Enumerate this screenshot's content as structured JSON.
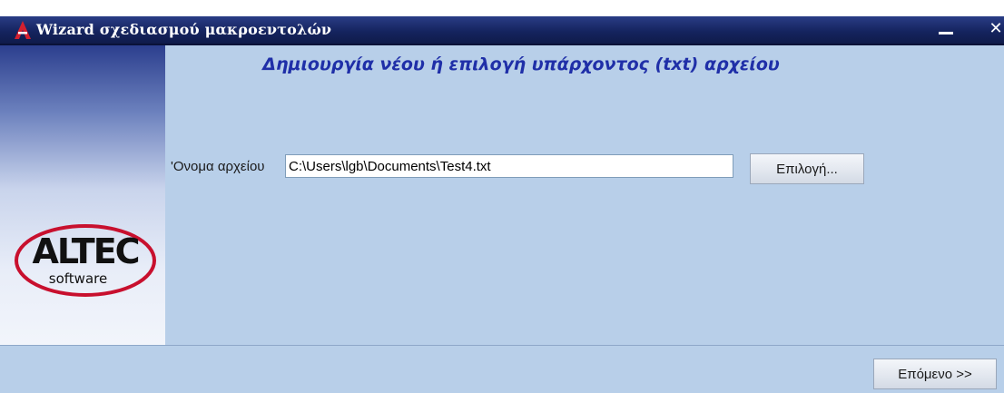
{
  "window": {
    "title": "Wizard σχεδιασμού μακροεντολών"
  },
  "brand": {
    "logo_text": "ALTEC",
    "logo_subtext": "software",
    "accent_red": "#c8102e",
    "title_bar_color": "#15245f"
  },
  "main": {
    "heading": "Δημιουργία νέου ή επιλογή υπάρχοντος (txt) αρχείου",
    "file_label": "'Ονομα αρχείου",
    "file_value": "C:\\Users\\lgb\\Documents\\Test4.txt",
    "browse_label": "Επιλογή..."
  },
  "footer": {
    "next_label": "Επόμενο >>"
  },
  "icons": {
    "app": "altec-app-icon",
    "minimize": "minimize-icon",
    "close": "close-icon"
  }
}
